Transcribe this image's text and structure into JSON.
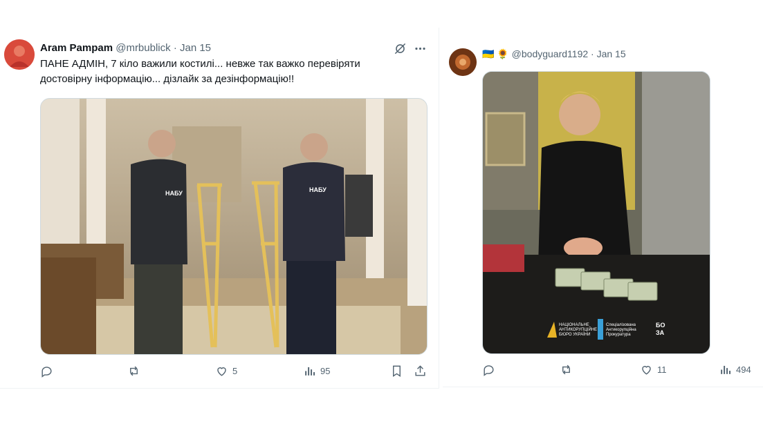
{
  "tweets": [
    {
      "author_name": "Aram Pampam",
      "handle": "@mrbublick",
      "separator": "·",
      "date": "Jan 15",
      "text_line1": "ПАНЕ АДМІН, 7 кіло важили костилі... невже так важко перевіряти",
      "text_line2": "достовірну інформацію... дізлайк за дезінформацію!!",
      "image_labels": {
        "vest_left": "НАБУ",
        "vest_right": "НАБУ"
      },
      "stats": {
        "replies": "",
        "reposts": "",
        "likes": "5",
        "views": "95"
      },
      "icons": [
        "grok-icon",
        "more-icon",
        "reply-icon",
        "repost-icon",
        "like-icon",
        "views-icon",
        "bookmark-icon",
        "share-icon"
      ]
    },
    {
      "author_flags": "🇺🇦 🌻",
      "handle": "@bodyguard1192",
      "separator": "·",
      "date": "Jan 15",
      "image_labels": {
        "logo1_line1": "НАЦІОНАЛЬНЕ",
        "logo1_line2": "АНТИКОРУПЦІЙНЕ",
        "logo1_line3": "БЮРО УКРАЇНИ",
        "logo2_line1": "Спеціалізована",
        "logo2_line2": "Антикорупційна",
        "logo2_line3": "Прокуратура",
        "logo3_line1": "БО",
        "logo3_line2": "ЗА"
      },
      "stats": {
        "replies": "",
        "reposts": "",
        "likes": "11",
        "views": "494"
      },
      "icons": [
        "reply-icon",
        "repost-icon",
        "like-icon",
        "views-icon"
      ]
    }
  ],
  "colors": {
    "text": "#0f1419",
    "muted": "#536471",
    "border": "#cfd9de"
  }
}
